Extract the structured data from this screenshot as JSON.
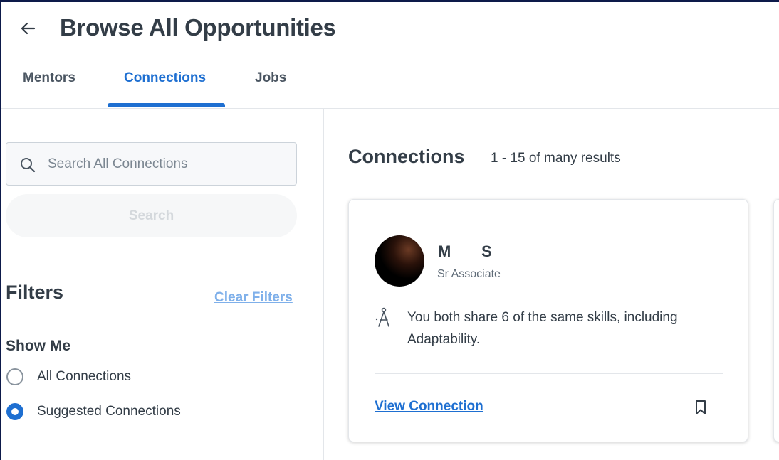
{
  "header": {
    "title": "Browse All Opportunities",
    "tabs": [
      {
        "label": "Mentors",
        "active": false
      },
      {
        "label": "Connections",
        "active": true
      },
      {
        "label": "Jobs",
        "active": false
      }
    ]
  },
  "sidebar": {
    "search_placeholder": "Search All Connections",
    "search_button": "Search",
    "filters_title": "Filters",
    "clear_filters": "Clear Filters",
    "show_me_title": "Show Me",
    "options": [
      {
        "label": "All Connections",
        "selected": false
      },
      {
        "label": "Suggested Connections",
        "selected": true
      }
    ]
  },
  "results": {
    "title": "Connections",
    "count_text": "1 - 15 of many results"
  },
  "card": {
    "name": "M       S",
    "role": "Sr Associate",
    "skills_text": "You both share 6 of the same skills, including Adaptability.",
    "view_link": "View Connection",
    "skills_icon": "compass-icon",
    "bookmark_icon": "bookmark-icon"
  },
  "colors": {
    "accent": "#1e6fd1",
    "text": "#333d47",
    "border": "#e3e6ea",
    "frame": "#0d1a4a"
  }
}
